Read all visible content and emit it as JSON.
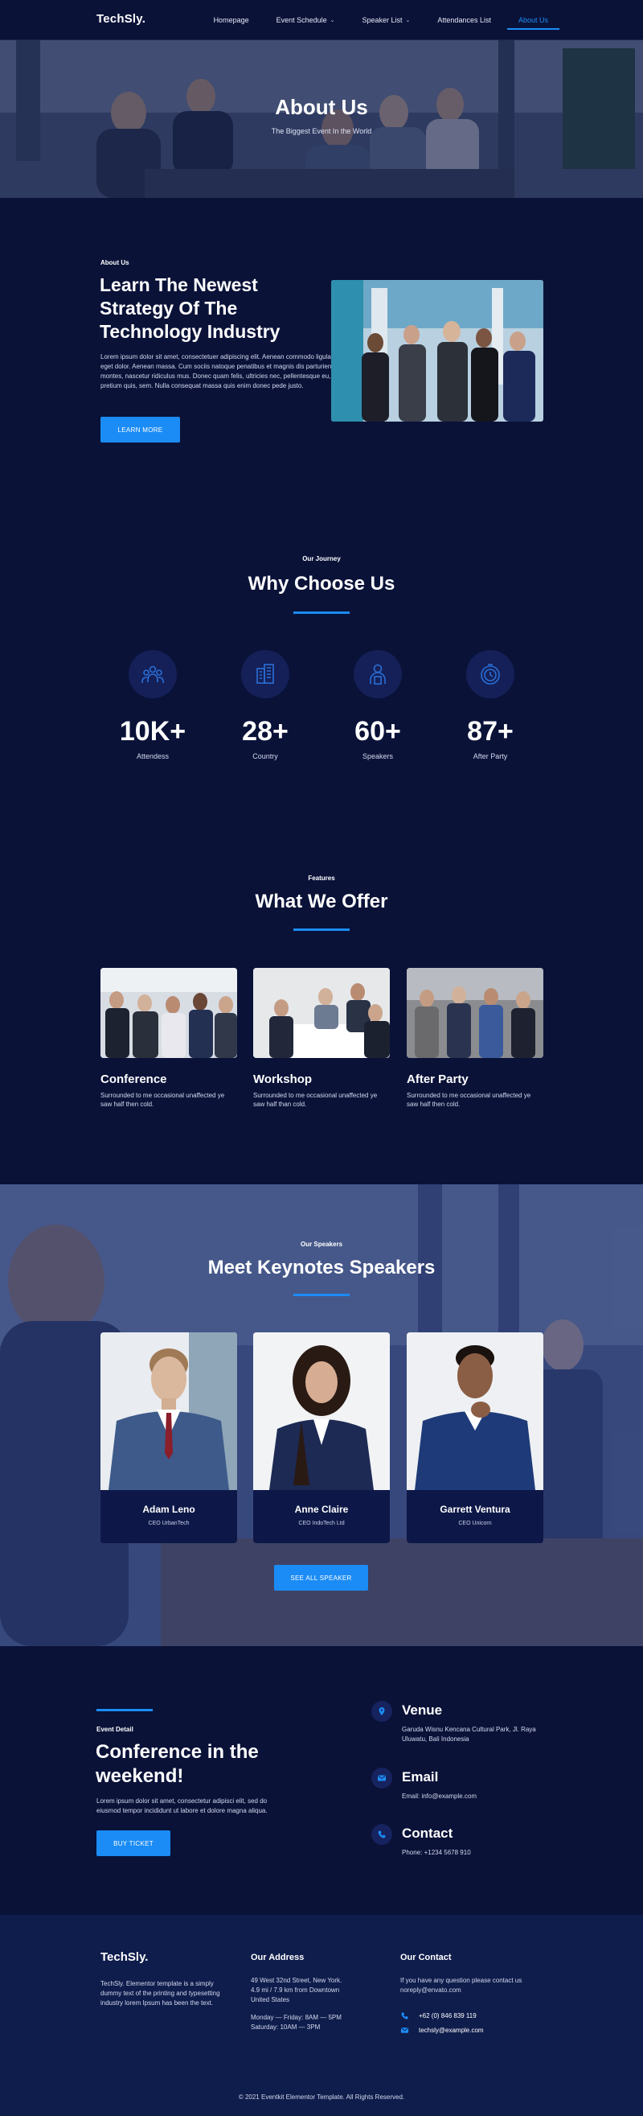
{
  "nav": {
    "logo": "TechSly.",
    "links": [
      {
        "label": "Homepage",
        "dropdown": false,
        "active": false
      },
      {
        "label": "Event Schedule",
        "dropdown": true,
        "active": false
      },
      {
        "label": "Speaker List",
        "dropdown": true,
        "active": false
      },
      {
        "label": "Attendances List",
        "dropdown": false,
        "active": false
      },
      {
        "label": "About Us",
        "dropdown": false,
        "active": true
      }
    ]
  },
  "hero": {
    "title": "About Us",
    "subtitle": "The Biggest Event In the World"
  },
  "about": {
    "label": "About Us",
    "title": "Learn The Newest Strategy Of The Technology Industry",
    "text": "Lorem ipsum dolor sit amet, consectetuer adipiscing elit. Aenean commodo ligula eget dolor. Aenean massa. Cum sociis natoque penatibus et magnis dis parturient montes, nascetur ridiculus mus. Donec quam felis, ultricies nec, pellentesque eu, pretium quis, sem. Nulla consequat massa quis enim donec pede justo.",
    "button": "LEARN MORE"
  },
  "journey": {
    "label": "Our Journey",
    "title": "Why Choose Us",
    "stats": [
      {
        "value": "10K+",
        "label": "Attendess",
        "icon": "people-group-icon"
      },
      {
        "value": "28+",
        "label": "Country",
        "icon": "building-icon"
      },
      {
        "value": "60+",
        "label": "Speakers",
        "icon": "speaker-person-icon"
      },
      {
        "value": "87+",
        "label": "After Party",
        "icon": "clock-icon"
      }
    ]
  },
  "offer": {
    "label": "Features",
    "title": "What We Offer",
    "cards": [
      {
        "title": "Conference",
        "text": "Surrounded to me occasional unaffected ye saw half then cold."
      },
      {
        "title": "Workshop",
        "text": "Surrounded to me occasional unaffected ye saw half than cold."
      },
      {
        "title": "After Party",
        "text": "Surrounded to me occasional unaffected ye saw half then cold."
      }
    ]
  },
  "speakers": {
    "label": "Our Speakers",
    "title": "Meet Keynotes Speakers",
    "list": [
      {
        "name": "Adam Leno",
        "role": "CEO UrbanTech"
      },
      {
        "name": "Anne Claire",
        "role": "CEO IndoTech Ltd"
      },
      {
        "name": "Garrett Ventura",
        "role": "CEO Unicorn"
      }
    ],
    "button": "SEE ALL SPEAKER"
  },
  "event": {
    "label": "Event Detail",
    "title": "Conference in the weekend!",
    "text": "Lorem ipsum dolor sit amet, consectetur adipisci elit, sed do eiusmod tempor incididunt ut labore et dolore magna aliqua.",
    "button": "BUY TICKET",
    "info": [
      {
        "title": "Venue",
        "text": "Garuda Wisnu Kencana Cultural Park, Jl. Raya Uluwatu, Bali Indonesia",
        "icon": "map-pin-icon"
      },
      {
        "title": "Email",
        "text": "Email: info@example.com",
        "icon": "envelope-icon"
      },
      {
        "title": "Contact",
        "text": "Phone: +1234 5678 910",
        "icon": "phone-icon"
      }
    ]
  },
  "footer": {
    "logo": "TechSly.",
    "about": "TechSly. Elementor template is a simply dummy text of the printing and typesetting industry lorem Ipsum has been the text.",
    "address_head": "Our Address",
    "address": "49 West 32nd Street, New York. 4.9 mi / 7.9 km from Downtown United States",
    "hours": "Monday — Friday: 8AM — 5PM Saturday: 10AM — 3PM",
    "contact_head": "Our Contact",
    "contact_text": "If you have any question please contact us noreply@envato.com",
    "phone": "+62 (0) 846 839 119",
    "email": "techsly@example.com",
    "copyright": "© 2021 Eventkit Elementor Template. All Rights Reserved."
  },
  "colors": {
    "background": "#0a1238",
    "accent": "#1b8cf5",
    "footer": "#0f1d4c"
  }
}
